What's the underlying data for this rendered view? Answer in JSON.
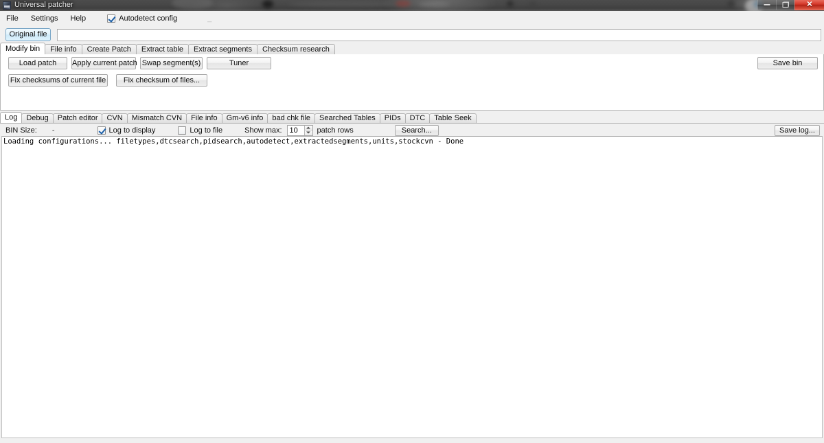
{
  "window": {
    "title": "Universal patcher",
    "icon": "app-icon",
    "controls": {
      "minimize": "minimize-icon",
      "maximize": "restore-icon",
      "close": "close-icon",
      "close_glyph": "✕"
    }
  },
  "menubar": {
    "items": [
      {
        "label": "File"
      },
      {
        "label": "Settings"
      },
      {
        "label": "Help"
      }
    ],
    "autodetect": {
      "label": "Autodetect config",
      "checked": true
    },
    "trailing_mark": "_"
  },
  "file_row": {
    "original_file_button": "Original file",
    "path_value": "",
    "path_placeholder": ""
  },
  "main_tabs": {
    "active": "Modify bin",
    "items": [
      {
        "label": "Modify bin"
      },
      {
        "label": "File info"
      },
      {
        "label": "Create Patch"
      },
      {
        "label": "Extract table"
      },
      {
        "label": "Extract segments"
      },
      {
        "label": "Checksum research"
      }
    ]
  },
  "modify_bin": {
    "row1": [
      {
        "label": "Load patch"
      },
      {
        "label": "Apply current patch"
      },
      {
        "label": "Swap segment(s)"
      },
      {
        "label": "Tuner"
      }
    ],
    "row2": [
      {
        "label": "Fix checksums of current file"
      },
      {
        "label": "Fix checksum of files..."
      }
    ],
    "save_bin": "Save bin"
  },
  "log_tabs": {
    "active": "Log",
    "items": [
      {
        "label": "Log"
      },
      {
        "label": "Debug"
      },
      {
        "label": "Patch editor"
      },
      {
        "label": "CVN"
      },
      {
        "label": "Mismatch CVN"
      },
      {
        "label": "File info"
      },
      {
        "label": "Gm-v6 info"
      },
      {
        "label": "bad chk file"
      },
      {
        "label": "Searched Tables"
      },
      {
        "label": "PIDs"
      },
      {
        "label": "DTC"
      },
      {
        "label": "Table Seek"
      }
    ]
  },
  "log_controls": {
    "bin_size_label": "BIN Size:",
    "bin_size_value": "-",
    "log_to_display": {
      "label": "Log to display",
      "checked": true
    },
    "log_to_file": {
      "label": "Log to file",
      "checked": false
    },
    "show_max_label": "Show max:",
    "show_max_value": "10",
    "patch_rows_label": "patch rows",
    "search_button": "Search...",
    "save_log_button": "Save log..."
  },
  "log_output": {
    "lines": [
      "Loading configurations... filetypes,dtcsearch,pidsearch,autodetect,extractedsegments,units,stockcvn - Done"
    ]
  },
  "colors": {
    "accent_blue": "#cfeaf9",
    "close_red": "#d4382a",
    "panel_bg": "#f0f0f0",
    "content_bg": "#ffffff"
  }
}
